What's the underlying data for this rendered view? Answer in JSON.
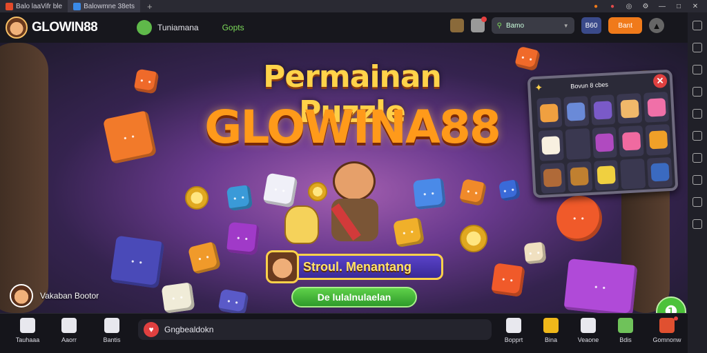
{
  "browser": {
    "tabs": [
      {
        "label": "Balo laaVifr ble",
        "active": false
      },
      {
        "label": "Balowmne 38ets",
        "active": true
      }
    ],
    "new_tab": "+",
    "window_controls": [
      "●",
      "●",
      "◎",
      "⚙",
      "—",
      "□",
      "✕"
    ]
  },
  "header": {
    "logo_text": "GLOWIN88",
    "nav": [
      "Tuniamana",
      "Gopts"
    ],
    "search": {
      "value": "Bamo"
    },
    "btn_blue": "B60",
    "btn_orange": "Bant"
  },
  "hero": {
    "title_line1": "Permainan Puzzle",
    "title_line2": "GLOWINA88",
    "banner_text": "Stroul. Menantang",
    "cta_label": "De lulalnulaelan",
    "user_name": "Vakaban Bootor",
    "game_panel": {
      "title": "Bovun 8 cbes",
      "close": "✕",
      "cell_colors": [
        "#f0a040",
        "#6a8ad8",
        "#7a5ac8",
        "#f0b86a",
        "#f070a8",
        "#f8f0e0",
        "#3a3850",
        "#b04ac0",
        "#f06aa0",
        "#f0a028",
        "#b06a38",
        "#c08030",
        "#f0d040",
        "#3a3850",
        "#3a6ac0"
      ]
    }
  },
  "bottom_nav": {
    "left": [
      "Tauhaaa",
      "Aaorr",
      "Bantis"
    ],
    "message": "Gngbealdokn",
    "right": [
      "Bopprt",
      "Bina",
      "Veaone",
      "Bdis",
      "Gomnonw"
    ]
  },
  "colors": {
    "accent_orange": "#f07a1a",
    "accent_green": "#4cc23a",
    "brand_gold": "#ffd24a"
  }
}
